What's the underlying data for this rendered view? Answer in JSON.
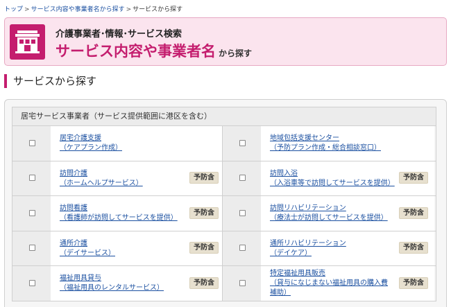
{
  "breadcrumb": {
    "items": [
      "トップ",
      "サービス内容や事業者名から探す",
      "サービスから探す"
    ],
    "separator": ">"
  },
  "hero": {
    "subtitle": "介護事業者･情報･サービス検索",
    "title": "サービス内容や事業者名",
    "title_suffix": "から探す",
    "icon": "building-icon"
  },
  "section": {
    "title": "サービスから探す"
  },
  "panel": {
    "header": "居宅サービス事業者（サービス提供範囲に港区を含む）",
    "rows": [
      {
        "left": {
          "line1": "居宅介護支援",
          "line2": "（ケアプラン作成）",
          "badge": ""
        },
        "right": {
          "line1": "地域包括支援センター",
          "line2": "（予防プラン作成・総合相談窓口）",
          "badge": ""
        }
      },
      {
        "left": {
          "line1": "訪問介護",
          "line2": "（ホームヘルプサービス）",
          "badge": "予防含"
        },
        "right": {
          "line1": "訪問入浴",
          "line2": "（入浴車等で訪問してサービスを提供）",
          "badge": "予防含"
        }
      },
      {
        "left": {
          "line1": "訪問看護",
          "line2": "（看護師が訪問してサービスを提供）",
          "badge": "予防含"
        },
        "right": {
          "line1": "訪問リハビリテーション",
          "line2": "（療法士が訪問してサービスを提供）",
          "badge": "予防含"
        }
      },
      {
        "left": {
          "line1": "通所介護",
          "line2": "（デイサービス）",
          "badge": "予防含"
        },
        "right": {
          "line1": "通所リハビリテーション",
          "line2": "（デイケア）",
          "badge": "予防含"
        }
      },
      {
        "left": {
          "line1": "福祉用具貸与",
          "line2": "（福祉用具のレンタルサービス）",
          "badge": "予防含"
        },
        "right": {
          "line1": "特定福祉用具販売",
          "line2": "（貸与になじまない福祉用具の購入費",
          "line3": "補助）",
          "badge": "予防含"
        }
      }
    ]
  },
  "colors": {
    "accent": "#c41d6e",
    "hero_bg": "#fbe4ee",
    "link": "#1a4fa0",
    "badge_bg": "#e7e0cf"
  }
}
